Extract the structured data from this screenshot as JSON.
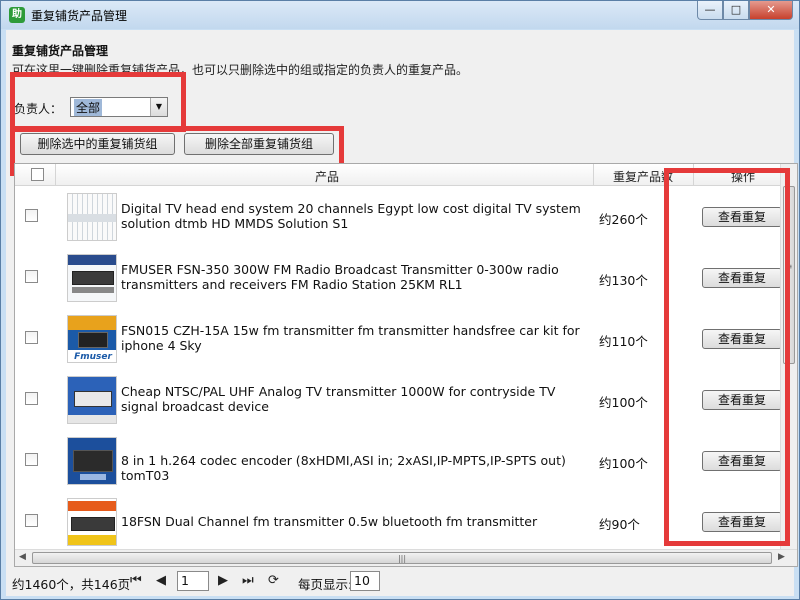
{
  "window": {
    "title": "重复铺货产品管理",
    "app_icon_glyph": "助",
    "controls": {
      "minimize": "—",
      "maximize": "□",
      "close": "✕"
    }
  },
  "header": {
    "heading": "重复铺货产品管理",
    "description": "可在这里一键删除重复铺货产品，也可以只删除选中的组或指定的负责人的重复产品。"
  },
  "filter": {
    "label": "负责人：",
    "selected": "全部",
    "arrow": "▼"
  },
  "actions": {
    "delete_selected": "删除选中的重复铺货组",
    "delete_all": "删除全部重复铺货组"
  },
  "colors": {
    "highlight": "#e53a3a",
    "selection": "#9fb8d8"
  },
  "table": {
    "columns": {
      "product": "产品",
      "dup_count": "重复产品数",
      "action": "操作"
    },
    "view_label": "查看重复",
    "rows": [
      {
        "title": "Digital TV head end system 20 channels Egypt low cost digital TV system solution dtmb HD MMDS Solution S1",
        "count": "约260个",
        "thumb": "headend-rack"
      },
      {
        "title": "FMUSER FSN-350 300W FM Radio Broadcast Transmitter 0-300w radio transmitters and receivers FM Radio Station 25KM RL1",
        "count": "约130个",
        "thumb": "fm-transmitter"
      },
      {
        "title": "FSN015 CZH-15A 15w fm transmitter fm transmitter handsfree car kit for iphone 4 Sky",
        "count": "约110个",
        "thumb": "fmuser-15w"
      },
      {
        "title": "Cheap NTSC/PAL UHF Analog TV transmitter 1000W for contryside TV signal broadcast device",
        "count": "约100个",
        "thumb": "uhf-transmitter"
      },
      {
        "title": "8 in 1 h.264 codec encoder (8xHDMI,ASI in; 2xASI,IP-MPTS,IP-SPTS out) tomT03",
        "count": "约100个",
        "thumb": "encoder"
      },
      {
        "title": "18FSN Dual Channel fm transmitter 0.5w bluetooth fm transmitter",
        "count": "约90个",
        "thumb": "dual-fm"
      }
    ]
  },
  "pager": {
    "summary": "约1460个，共146页",
    "page": "1",
    "page_size_label": "每页显示:",
    "page_size": "10"
  }
}
